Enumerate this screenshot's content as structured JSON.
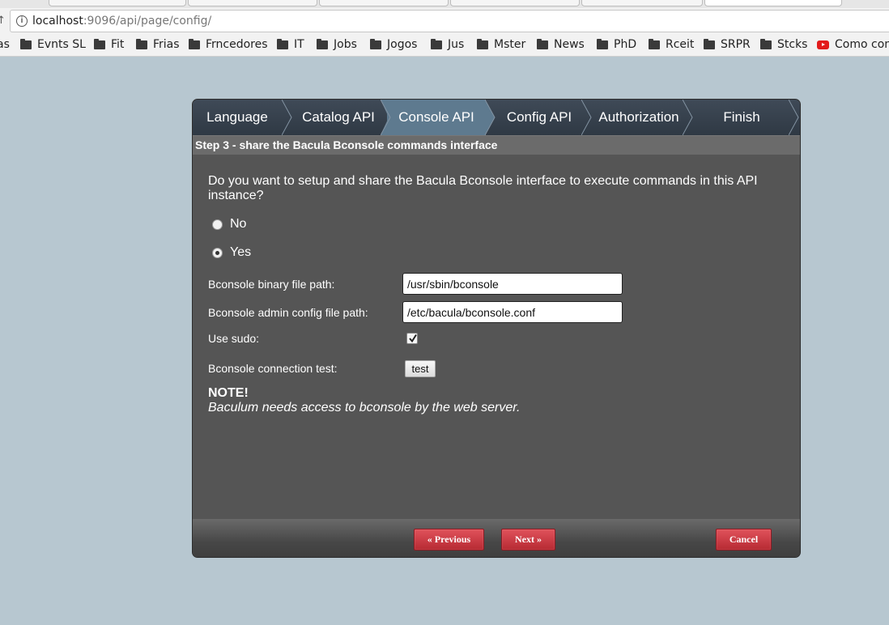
{
  "browser": {
    "url_host": "localhost",
    "url_rest": ":9096/api/page/config/"
  },
  "bookmarks": [
    {
      "label": "as",
      "icon": "none"
    },
    {
      "label": "Evnts SL",
      "icon": "folder-icon"
    },
    {
      "label": "Fit",
      "icon": "folder-icon"
    },
    {
      "label": "Frias",
      "icon": "folder-icon"
    },
    {
      "label": "Frncedores",
      "icon": "folder-icon"
    },
    {
      "label": "IT",
      "icon": "folder-icon"
    },
    {
      "label": "Jobs",
      "icon": "folder-icon"
    },
    {
      "label": "Jogos",
      "icon": "folder-icon"
    },
    {
      "label": "Jus",
      "icon": "folder-icon"
    },
    {
      "label": "Mster",
      "icon": "folder-icon"
    },
    {
      "label": "News",
      "icon": "folder-icon"
    },
    {
      "label": "PhD",
      "icon": "folder-icon"
    },
    {
      "label": "Rceit",
      "icon": "folder-icon"
    },
    {
      "label": "SRPR",
      "icon": "folder-icon"
    },
    {
      "label": "Stcks",
      "icon": "folder-icon"
    },
    {
      "label": "Como con",
      "icon": "youtube-icon"
    }
  ],
  "wizard": {
    "steps": [
      {
        "label": "Language"
      },
      {
        "label": "Catalog API"
      },
      {
        "label": "Console API"
      },
      {
        "label": "Config API"
      },
      {
        "label": "Authorization"
      },
      {
        "label": "Finish"
      }
    ],
    "active_step": 2,
    "step_title": "Step 3 - share the Bacula Bconsole commands interface",
    "question": "Do you want to setup and share the Bacula Bconsole interface to execute commands in this API instance?",
    "options": [
      {
        "label": "No",
        "checked": false
      },
      {
        "label": "Yes",
        "checked": true
      }
    ],
    "fields": {
      "binary_label": "Bconsole binary file path:",
      "binary_value": "/usr/sbin/bconsole",
      "config_label": "Bconsole admin config file path:",
      "config_value": "/etc/bacula/bconsole.conf",
      "sudo_label": "Use sudo:",
      "sudo_checked": true,
      "test_label": "Bconsole connection test:",
      "test_button": "test"
    },
    "note_title": "NOTE!",
    "note_text": "Baculum needs access to bconsole by the web server.",
    "buttons": {
      "previous": "« Previous",
      "next": "Next »",
      "cancel": "Cancel"
    },
    "colors": {
      "active_step": "#5e7a8f",
      "panel_bg": "#555555",
      "button_red": "#c9373f"
    }
  }
}
